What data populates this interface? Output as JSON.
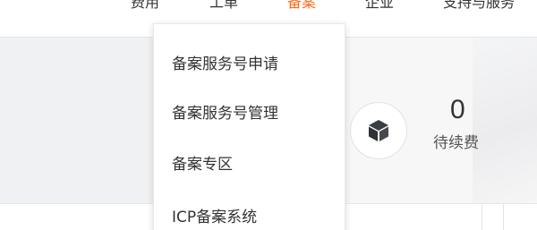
{
  "nav": {
    "items": [
      {
        "label": "费用",
        "active": false
      },
      {
        "label": "工单",
        "active": false
      },
      {
        "label": "备案",
        "active": true
      },
      {
        "label": "企业",
        "active": false
      },
      {
        "label": "支持与服务",
        "active": false
      }
    ],
    "active_color": "#f26b1d"
  },
  "beian_menu": {
    "items": [
      {
        "label": "备案服务号申请"
      },
      {
        "label": "备案服务号管理"
      },
      {
        "label": "备案专区"
      },
      {
        "label": "ICP备案系统"
      }
    ]
  },
  "renewal_stat": {
    "value": "0",
    "label": "待续费",
    "icon": "cube-icon"
  }
}
